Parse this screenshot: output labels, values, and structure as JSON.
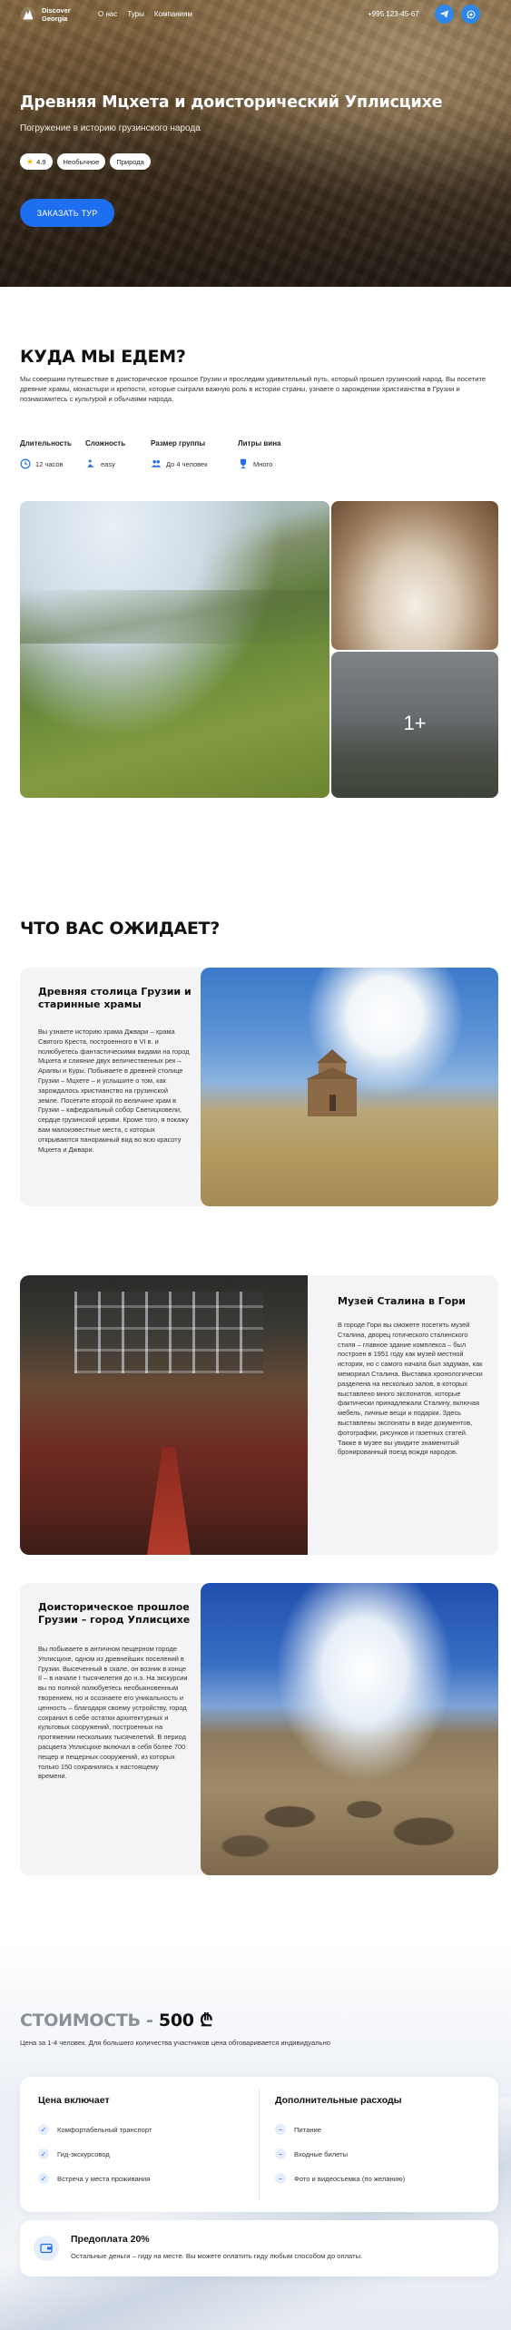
{
  "header": {
    "logo_line1": "Discover",
    "logo_line2": "Georgia",
    "nav": [
      "О нас",
      "Туры",
      "Компаниям"
    ],
    "phone": "+995 123-45-67"
  },
  "hero": {
    "title": "Древняя Мцхета и доисторический Уплисцихе",
    "subtitle": "Погружение в историю грузинского народа",
    "rating": "4.9",
    "tags": [
      "Необычное",
      "Природа"
    ],
    "cta": "ЗАКАЗАТЬ ТУР"
  },
  "where": {
    "heading": "КУДА МЫ ЕДЕМ?",
    "intro": "Мы совершим путешествие в доисторическое прошлое Грузии и проследим удивительный путь, который прошел грузинский народ. Вы посетите древние храмы, монастыри и крепости, которые сыграли важную роль в истории страны, узнаете о зарождении христианства в Грузии и познакомитесь с культурой и обычаями народа.",
    "facts": [
      {
        "label": "Длительность",
        "value": "12 часов",
        "icon": "clock-icon"
      },
      {
        "label": "Сложность",
        "value": "easy",
        "icon": "walker-icon"
      },
      {
        "label": "Размер группы",
        "value": "До 4 человек",
        "icon": "group-icon"
      },
      {
        "label": "Литры вина",
        "value": "Много",
        "icon": "wine-icon"
      }
    ],
    "more_photos": "1+"
  },
  "expect": {
    "heading": "ЧТО ВАС ОЖИДАЕТ?",
    "items": [
      {
        "title": "Древняя столица Грузии и старинные храмы",
        "text": "Вы узнаете историю храма Джвари – храма Святого Креста, построенного в VI в. и полюбуетесь фантастическими видами на город Мцхета и слияние двух величественных рек – Арагвы и Куры. Побываете в древней столице Грузии – Мцхете – и услышите о том, как зарождалось христианство на грузинской земле. Посетите второй по величине храм в Грузии – кафедральный собор Светицховели, сердце грузинской церкви. Кроме того, я покажу вам малоизвестные места, с которых открываются панорамный вид во всю красоту Мцхета и Джвари."
      },
      {
        "title": "Музей Сталина в Гори",
        "text": "В городе Гори вы сможете посетить музей Сталина, дворец готического сталинского стиля – главное здание комплекса – был построен в 1951 году как музей местной истории, но с самого начала был задуман, как мемориал Сталина. Выставка хронологически разделена на несколько залов, в которых выставлено много экспонатов, которые фактически принадлежали Сталину, включая мебель, личные вещи и подарки. Здесь выставлены экспонаты в виде документов, фотографии, рисунков и газетных статей. Также в музее вы увидите знаменитый бронированный поезд вождя народов."
      },
      {
        "title": "Доисторическое прошлое Грузии – город Уплисцихе",
        "text": "Вы побываете в античном пещерном городе Уплисцихе, одном из древнейших поселений в Грузии. Высеченный в скале, он возник в конце II – в начале I тысячелетия до н.э. На экскурсии вы по полной полюбуетесь необыкновенным творением, но и осознаете его уникальность и ценность – благодаря своему устройству, город сохранил в себе остатки архитектурных и культовых сооружений, построенных на протяжении нескольких тысячелетий. В период расцвета Уплисцихе включал в себя более 700 пещер и пещерных сооружений, из которых только 150 сохранились к настоящему времени."
      }
    ]
  },
  "price": {
    "label": "СТОИМОСТЬ - ",
    "amount": "500",
    "currency": "₾",
    "note": "Цена за 1-4 человек. Для большего количества участников цена обговаривается индивидуально",
    "included_title": "Цена включает",
    "included": [
      "Комфортабельный транспорт",
      "Гид-экскурсовод",
      "Встреча у места проживания"
    ],
    "extra_title": "Дополнительные расходы",
    "extra": [
      "Питание",
      "Входные билеты",
      "Фото и видеосъемка (по желанию)"
    ],
    "prepay_title": "Предоплата 20%",
    "prepay_text": "Остальные деньги – гиду на месте. Вы можете оплатить гиду любым способом до оплаты."
  },
  "colors": {
    "accent": "#1e6ef0",
    "muted": "#8a8f98"
  }
}
